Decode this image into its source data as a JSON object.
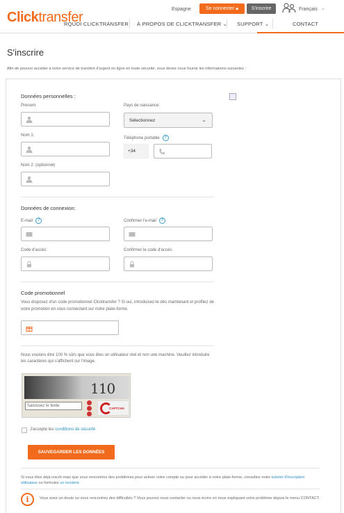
{
  "header": {
    "logo_part1": "Click",
    "logo_part2": "transfer",
    "country": "Espagne",
    "login_label": "Se connecter",
    "register_label": "S'inscrire",
    "language": "Français",
    "nav": [
      "RQUOI CLICKTRANSFER",
      "À PROPOS DE CLICKTRANSFER",
      "SUPPORT",
      "CONTACT"
    ]
  },
  "page": {
    "title": "S'inscrire",
    "intro": "Afin de pouvoir accéder à notre service de transfert d'argent en ligne en toute sécurité, vous devez nous fournir les informations suivantes :"
  },
  "personal": {
    "title": "Données personnelles :",
    "firstname_label": "Prenom:",
    "lastname1_label": "Nom 1:",
    "lastname2_label": "Nom 2: (optionnel)",
    "birth_country_label": "Pays de naissance:",
    "birth_country_value": "Sélectionnez",
    "phone_label": "Téléphone portable",
    "phone_prefix": "+34"
  },
  "login": {
    "title": "Données de connexion:",
    "email_label": "E-mail",
    "confirm_email_label": "Confirmer l'e-mail",
    "password_label": "Code d'accès:",
    "confirm_password_label": "Confirmer le code d'accès:"
  },
  "promo": {
    "title": "Code promotionnel",
    "text": "Vous disposez d'un code promotionnel Clicktransfer ? Si oui, introduisez-le dès maintenant et profitez de votre promotion en vous connectant sur notre plate-forme."
  },
  "captcha": {
    "text": "Nous voulons être 100 % sûrs que vous êtes un utilisateur réel et non une machine. Veuillez introduire les caractères qui s'affichent sur l'image.",
    "word": "110",
    "input_placeholder": "Saisissez le texte",
    "logo_text": "CAPTCHA"
  },
  "terms": {
    "prefix": "J'accepte les ",
    "link": "conditions de sécurité"
  },
  "submit_label": "SAUVEGARDER LES DONNÉES",
  "footer": {
    "line1_start": "Si vous êtes déjà inscrit mais que vous rencontrez des problèmes pour activer votre compte ou pour accéder à notre plate-forme, consultez notre ",
    "line1_link1": "tutoriel d'inscription utilisateur",
    "line1_mid": " ou formulez ",
    "line1_link2": "un incident",
    "line1_end": ".",
    "line2": "Vous avez un doute ou vous rencontrez des difficultés ? Vous pouvez nous contacter ou nous écrire en nous expliquant votre problème depuis le menu CONTACT."
  },
  "colors": {
    "accent": "#f26b1d",
    "link": "#2a8fc2",
    "help": "#3a9ecf"
  }
}
